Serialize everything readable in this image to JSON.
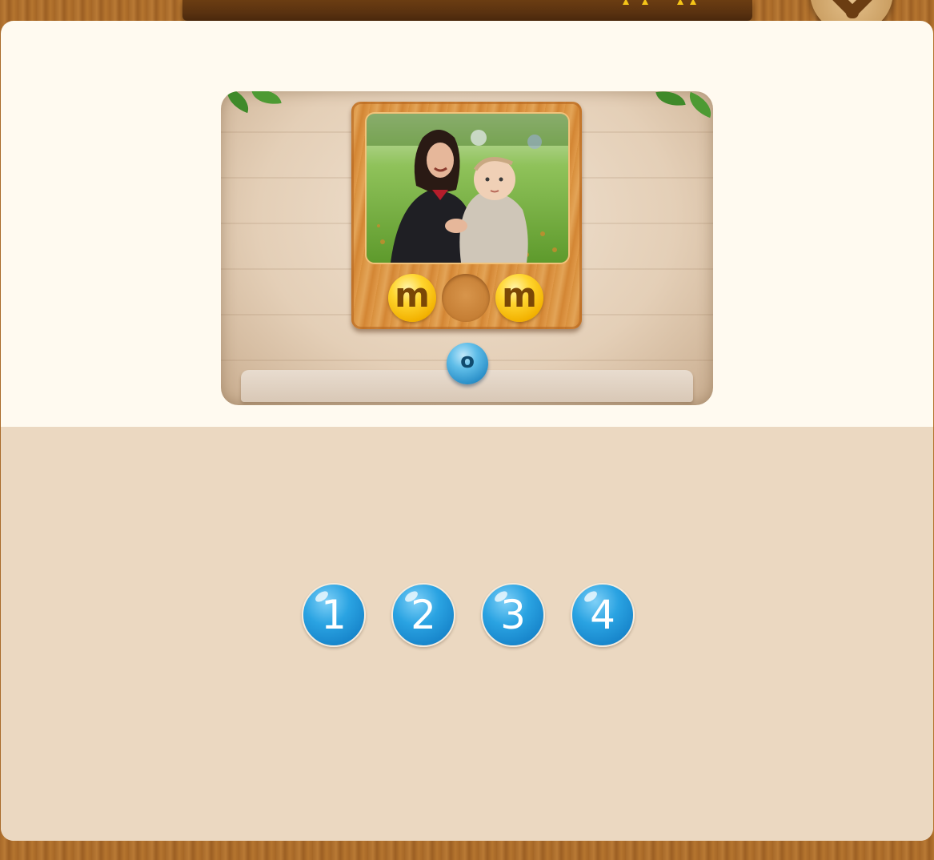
{
  "top_banner": {
    "star_icon": "star-icon"
  },
  "close_button": {
    "icon": "close-icon"
  },
  "puzzle": {
    "photo_icon": "mother-and-baby-photo",
    "word_slots": [
      {
        "letter": "m",
        "filled": true
      },
      {
        "letter": "",
        "filled": false
      },
      {
        "letter": "m",
        "filled": true
      }
    ],
    "draggable_letter": "o"
  },
  "number_options": [
    "1",
    "2",
    "3",
    "4"
  ],
  "colors": {
    "letter_ball": "#ffd52e",
    "blue_ball": "#2a8fc8",
    "panel_top": "#fffaf0",
    "panel_bottom": "#ebd8c1",
    "wood": "#b97a35"
  }
}
